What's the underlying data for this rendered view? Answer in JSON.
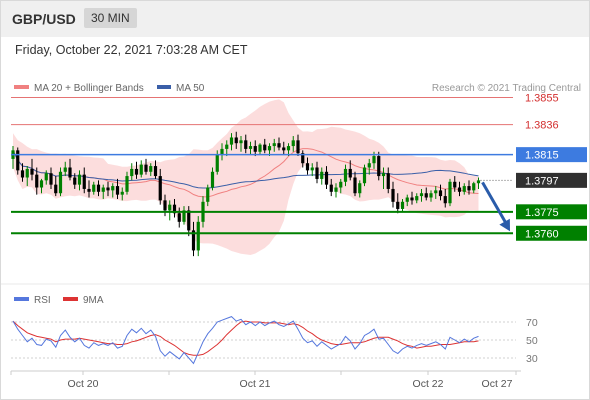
{
  "header": {
    "symbol": "GBP/USD",
    "timeframe": "30 MIN",
    "datetime": "Friday, October 22, 2021 7:03:28 AM CET"
  },
  "legend": {
    "ma20_bb": "MA 20 + Bollinger Bands",
    "ma50": "MA 50",
    "credit": "Research © 2021 Trading Central"
  },
  "rsi_legend": {
    "rsi": "RSI",
    "ma9": "9MA"
  },
  "colors": {
    "ma20": "#f08080",
    "bollinger_fill": "#fbd7d7",
    "ma50": "#3a5fa8",
    "resistance": "#e57373",
    "pivot": "#3d7be0",
    "support": "#008000",
    "rsi": "#5577dd",
    "rsi_ma": "#dd3333",
    "arrow": "#2a5caa",
    "up_candle": "#008000",
    "down_candle": "#000000",
    "current_price_box": "#303030"
  },
  "chart_data": [
    {
      "type": "candlestick",
      "title": "GBP/USD",
      "ylim": [
        1.3735,
        1.387
      ],
      "x_tick_labels": [
        "Oct 20",
        "Oct 21",
        "Oct 22",
        "Oct 27"
      ],
      "levels": [
        {
          "value": 1.3855,
          "label": "1.3855",
          "kind": "resistance"
        },
        {
          "value": 1.3836,
          "label": "1.3836",
          "kind": "resistance"
        },
        {
          "value": 1.3815,
          "label": "1.3815",
          "kind": "pivot"
        },
        {
          "value": 1.3775,
          "label": "1.3775",
          "kind": "support"
        },
        {
          "value": 1.376,
          "label": "1.3760",
          "kind": "support"
        }
      ],
      "current_price": {
        "value": 1.3797,
        "label": "1.3797"
      },
      "forecast_target": 1.376,
      "candles": [
        [
          1.3812,
          1.3821,
          1.3805,
          1.3818
        ],
        [
          1.3818,
          1.382,
          1.3801,
          1.3804
        ],
        [
          1.3804,
          1.3809,
          1.3796,
          1.3799
        ],
        [
          1.3799,
          1.3807,
          1.3793,
          1.3805
        ],
        [
          1.3805,
          1.3812,
          1.3797,
          1.3801
        ],
        [
          1.3801,
          1.3806,
          1.3787,
          1.3792
        ],
        [
          1.3792,
          1.3798,
          1.3788,
          1.3797
        ],
        [
          1.3797,
          1.3804,
          1.3794,
          1.3802
        ],
        [
          1.3802,
          1.3806,
          1.3791,
          1.3794
        ],
        [
          1.3794,
          1.38,
          1.3786,
          1.3788
        ],
        [
          1.3788,
          1.3806,
          1.3786,
          1.3803
        ],
        [
          1.3803,
          1.381,
          1.38,
          1.3806
        ],
        [
          1.3806,
          1.3812,
          1.3797,
          1.3799
        ],
        [
          1.3799,
          1.3802,
          1.3791,
          1.3794
        ],
        [
          1.3794,
          1.3804,
          1.379,
          1.3801
        ],
        [
          1.3801,
          1.3806,
          1.3788,
          1.3791
        ],
        [
          1.3791,
          1.3797,
          1.3785,
          1.3789
        ],
        [
          1.3789,
          1.3796,
          1.3787,
          1.3794
        ],
        [
          1.3794,
          1.3797,
          1.3786,
          1.3789
        ],
        [
          1.3789,
          1.3794,
          1.3784,
          1.3792
        ],
        [
          1.3792,
          1.3796,
          1.3786,
          1.379
        ],
        [
          1.379,
          1.3795,
          1.3785,
          1.3793
        ],
        [
          1.3793,
          1.3798,
          1.3784,
          1.3787
        ],
        [
          1.3787,
          1.3792,
          1.3783,
          1.3789
        ],
        [
          1.3789,
          1.3803,
          1.3787,
          1.38
        ],
        [
          1.38,
          1.3809,
          1.3797,
          1.3805
        ],
        [
          1.3805,
          1.381,
          1.3798,
          1.3801
        ],
        [
          1.3801,
          1.3811,
          1.3799,
          1.3808
        ],
        [
          1.3808,
          1.3812,
          1.3801,
          1.3803
        ],
        [
          1.3803,
          1.3809,
          1.38,
          1.3807
        ],
        [
          1.3807,
          1.3811,
          1.3798,
          1.38
        ],
        [
          1.38,
          1.3805,
          1.378,
          1.3783
        ],
        [
          1.3783,
          1.3787,
          1.3772,
          1.3776
        ],
        [
          1.3776,
          1.3783,
          1.3769,
          1.378
        ],
        [
          1.378,
          1.3784,
          1.3771,
          1.3774
        ],
        [
          1.3774,
          1.3778,
          1.3764,
          1.3768
        ],
        [
          1.3768,
          1.3779,
          1.3766,
          1.3776
        ],
        [
          1.3776,
          1.3779,
          1.3758,
          1.3762
        ],
        [
          1.3762,
          1.3768,
          1.3744,
          1.3748
        ],
        [
          1.3748,
          1.3772,
          1.3744,
          1.3768
        ],
        [
          1.3768,
          1.3786,
          1.3764,
          1.3782
        ],
        [
          1.3782,
          1.3794,
          1.3779,
          1.3792
        ],
        [
          1.3792,
          1.3806,
          1.379,
          1.3803
        ],
        [
          1.3803,
          1.3818,
          1.3801,
          1.3815
        ],
        [
          1.3815,
          1.3823,
          1.3811,
          1.3819
        ],
        [
          1.3819,
          1.3825,
          1.3814,
          1.3822
        ],
        [
          1.3822,
          1.383,
          1.3818,
          1.3827
        ],
        [
          1.3827,
          1.3831,
          1.3819,
          1.3823
        ],
        [
          1.3823,
          1.3828,
          1.3817,
          1.3825
        ],
        [
          1.3825,
          1.3829,
          1.3816,
          1.3819
        ],
        [
          1.3819,
          1.3824,
          1.3815,
          1.3821
        ],
        [
          1.3821,
          1.3825,
          1.3814,
          1.3817
        ],
        [
          1.3817,
          1.3823,
          1.3815,
          1.3822
        ],
        [
          1.3822,
          1.3826,
          1.3816,
          1.3818
        ],
        [
          1.3818,
          1.3823,
          1.3814,
          1.3821
        ],
        [
          1.3821,
          1.3826,
          1.3817,
          1.3823
        ],
        [
          1.3823,
          1.3827,
          1.3818,
          1.382
        ],
        [
          1.382,
          1.3824,
          1.3815,
          1.3818
        ],
        [
          1.3818,
          1.3823,
          1.3814,
          1.3821
        ],
        [
          1.3821,
          1.3828,
          1.3817,
          1.3825
        ],
        [
          1.3825,
          1.3829,
          1.3814,
          1.3816
        ],
        [
          1.3816,
          1.3818,
          1.3806,
          1.3809
        ],
        [
          1.3809,
          1.3813,
          1.3801,
          1.3804
        ],
        [
          1.3804,
          1.3809,
          1.38,
          1.3806
        ],
        [
          1.3806,
          1.381,
          1.3795,
          1.3798
        ],
        [
          1.3798,
          1.3806,
          1.3794,
          1.3803
        ],
        [
          1.3803,
          1.3807,
          1.3791,
          1.3794
        ],
        [
          1.3794,
          1.3798,
          1.3786,
          1.3789
        ],
        [
          1.3789,
          1.3795,
          1.3785,
          1.3792
        ],
        [
          1.3792,
          1.3798,
          1.3788,
          1.3796
        ],
        [
          1.3796,
          1.3808,
          1.3793,
          1.3805
        ],
        [
          1.3805,
          1.3811,
          1.3797,
          1.3799
        ],
        [
          1.3799,
          1.3803,
          1.3786,
          1.3788
        ],
        [
          1.3788,
          1.3797,
          1.3785,
          1.3795
        ],
        [
          1.3795,
          1.3808,
          1.3793,
          1.3806
        ],
        [
          1.3806,
          1.3812,
          1.3801,
          1.3809
        ],
        [
          1.3809,
          1.3817,
          1.3805,
          1.3814
        ],
        [
          1.3814,
          1.3817,
          1.3797,
          1.38
        ],
        [
          1.38,
          1.3806,
          1.3791,
          1.3802
        ],
        [
          1.3802,
          1.3806,
          1.3788,
          1.3791
        ],
        [
          1.3791,
          1.3796,
          1.3778,
          1.3782
        ],
        [
          1.3782,
          1.3788,
          1.3774,
          1.3777
        ],
        [
          1.3777,
          1.3784,
          1.3775,
          1.3782
        ],
        [
          1.3782,
          1.3787,
          1.3779,
          1.3785
        ],
        [
          1.3785,
          1.3789,
          1.378,
          1.3783
        ],
        [
          1.3783,
          1.3788,
          1.3781,
          1.3786
        ],
        [
          1.3786,
          1.3791,
          1.3782,
          1.3788
        ],
        [
          1.3788,
          1.3792,
          1.3783,
          1.3785
        ],
        [
          1.3785,
          1.379,
          1.3782,
          1.3788
        ],
        [
          1.3788,
          1.3793,
          1.3784,
          1.379
        ],
        [
          1.379,
          1.3794,
          1.3783,
          1.3786
        ],
        [
          1.3786,
          1.3791,
          1.3778,
          1.3781
        ],
        [
          1.3781,
          1.3798,
          1.3779,
          1.3796
        ],
        [
          1.3796,
          1.38,
          1.3789,
          1.3792
        ],
        [
          1.3792,
          1.3796,
          1.3786,
          1.3789
        ],
        [
          1.3789,
          1.3795,
          1.3787,
          1.3793
        ],
        [
          1.3793,
          1.3797,
          1.3787,
          1.379
        ],
        [
          1.379,
          1.3796,
          1.3788,
          1.3795
        ],
        [
          1.3795,
          1.3799,
          1.3791,
          1.3797
        ]
      ]
    },
    {
      "type": "line",
      "title": "RSI",
      "ylim": [
        20,
        80
      ],
      "y_ticks": [
        30,
        50,
        70
      ],
      "series": [
        {
          "name": "RSI",
          "values": [
            71,
            62,
            55,
            48,
            52,
            45,
            44,
            51,
            49,
            42,
            55,
            61,
            53,
            48,
            52,
            44,
            41,
            47,
            44,
            46,
            44,
            47,
            41,
            43,
            55,
            62,
            58,
            63,
            57,
            61,
            54,
            38,
            32,
            37,
            33,
            29,
            36,
            30,
            24,
            36,
            48,
            57,
            63,
            70,
            72,
            74,
            76,
            71,
            73,
            67,
            70,
            66,
            70,
            66,
            69,
            71,
            67,
            65,
            68,
            71,
            62,
            52,
            47,
            49,
            43,
            48,
            44,
            40,
            43,
            46,
            54,
            49,
            40,
            46,
            55,
            58,
            62,
            51,
            52,
            45,
            38,
            35,
            40,
            43,
            41,
            44,
            46,
            44,
            46,
            48,
            45,
            40,
            53,
            50,
            47,
            51,
            48,
            52,
            54
          ]
        },
        {
          "name": "9MA",
          "values": [
            71,
            66,
            62,
            58,
            56,
            54,
            53,
            52,
            51,
            48,
            50,
            51,
            51,
            51,
            52,
            51,
            50,
            49,
            48,
            47,
            46,
            46,
            45,
            45,
            46,
            48,
            49,
            51,
            53,
            55,
            56,
            54,
            50,
            47,
            44,
            40,
            36,
            34,
            33,
            33,
            34,
            37,
            41,
            45,
            50,
            56,
            61,
            66,
            70,
            71,
            70,
            70,
            70,
            69,
            69,
            69,
            69,
            68,
            67,
            68,
            67,
            64,
            60,
            57,
            53,
            50,
            48,
            46,
            45,
            45,
            46,
            47,
            47,
            47,
            48,
            50,
            52,
            53,
            53,
            53,
            51,
            49,
            46,
            44,
            43,
            41,
            42,
            43,
            43,
            44,
            45,
            45,
            45,
            46,
            47,
            48,
            48,
            48,
            49
          ]
        }
      ]
    }
  ]
}
